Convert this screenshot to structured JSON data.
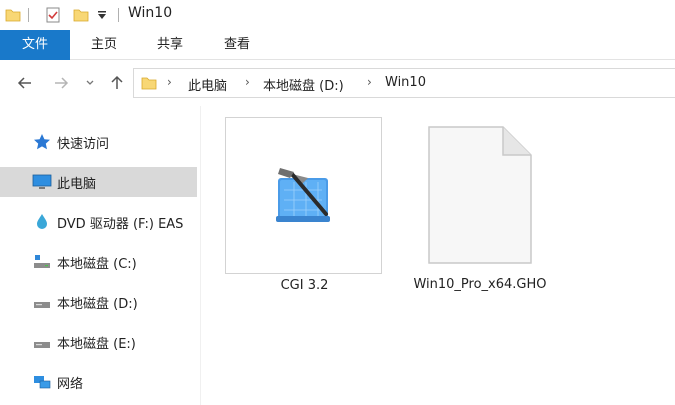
{
  "window": {
    "title": "Win10"
  },
  "ribbon": {
    "tabs": [
      {
        "label": "文件",
        "active": true
      },
      {
        "label": "主页"
      },
      {
        "label": "共享"
      },
      {
        "label": "查看"
      }
    ],
    "accent_color": "#1979ca"
  },
  "address": {
    "crumbs": [
      "此电脑",
      "本地磁盘 (D:)",
      "Win10"
    ]
  },
  "sidebar": {
    "items": [
      {
        "label": "快速访问",
        "icon": "star-icon"
      },
      {
        "label": "此电脑",
        "icon": "computer-icon",
        "selected": true
      },
      {
        "label": "DVD 驱动器 (F:) EAS",
        "icon": "dvd-icon"
      },
      {
        "label": "本地磁盘 (C:)",
        "icon": "system-drive-icon"
      },
      {
        "label": "本地磁盘 (D:)",
        "icon": "drive-icon"
      },
      {
        "label": "本地磁盘 (E:)",
        "icon": "drive-icon"
      },
      {
        "label": "网络",
        "icon": "network-icon"
      }
    ]
  },
  "files": [
    {
      "name": "CGI 3.2",
      "icon": "app-tools-icon",
      "selected": true
    },
    {
      "name": "Win10_Pro_x64.GHO",
      "icon": "blank-file-icon"
    }
  ]
}
